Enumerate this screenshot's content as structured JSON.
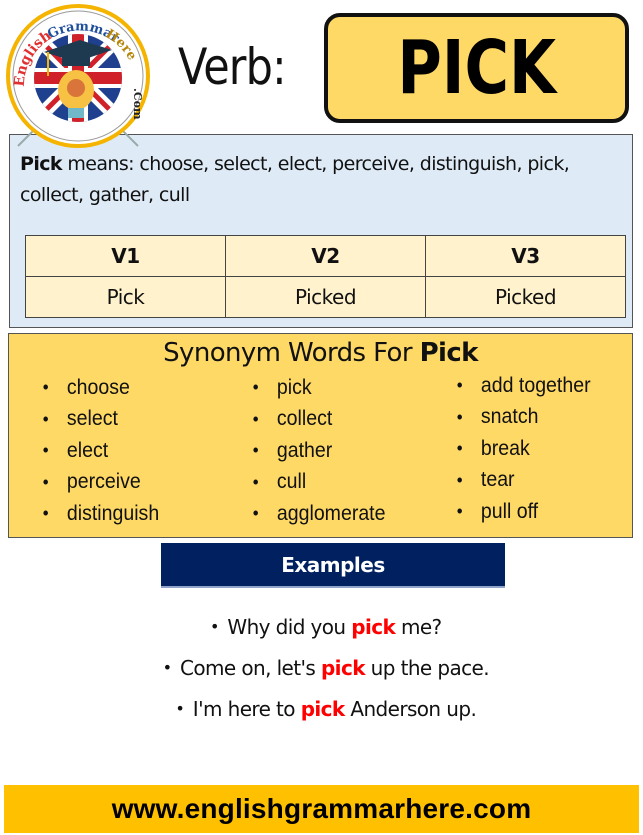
{
  "logo": {
    "text_top": "English Grammar Here",
    "text_side": ".Com",
    "icon": "graduation-cap-lightbulb-union-jack-logo",
    "colors": {
      "ring": "#f5b400",
      "red_text": "#e03030",
      "blue_text": "#1f4e9c",
      "gold_text": "#b8860b"
    }
  },
  "header": {
    "verb_label": "Verb:",
    "verb_word": "PICK",
    "box_color": "#ffd966"
  },
  "meaning": {
    "bold_word": "Pick",
    "text": " means: choose, select, elect, perceive, distinguish, pick, collect, gather, cull",
    "panel_color": "#deebf7"
  },
  "forms_table": {
    "headers": [
      "V1",
      "V2",
      "V3"
    ],
    "values": [
      "Pick",
      "Picked",
      "Picked"
    ],
    "color": "#fff2cc"
  },
  "synonyms": {
    "title_prefix": "Synonym Words For ",
    "title_bold": "Pick",
    "panel_color": "#ffd966",
    "columns": [
      [
        "choose",
        "select",
        "elect",
        "perceive",
        "distinguish"
      ],
      [
        "pick",
        "collect",
        "gather",
        "cull",
        "agglomerate"
      ],
      [
        "add together",
        "snatch",
        "break",
        "tear",
        "pull off"
      ]
    ]
  },
  "examples": {
    "header": "Examples",
    "header_color": "#002060",
    "highlight_color": "#ff0000",
    "sentences": [
      {
        "before": "Why did you ",
        "highlight": "pick",
        "after": " me?"
      },
      {
        "before": "Come on, let's ",
        "highlight": "pick",
        "after": " up the pace."
      },
      {
        "before": "I'm here to ",
        "highlight": "pick",
        "after": " Anderson up."
      }
    ]
  },
  "footer": {
    "url": "www.englishgrammarhere.com",
    "color": "#ffc000"
  }
}
